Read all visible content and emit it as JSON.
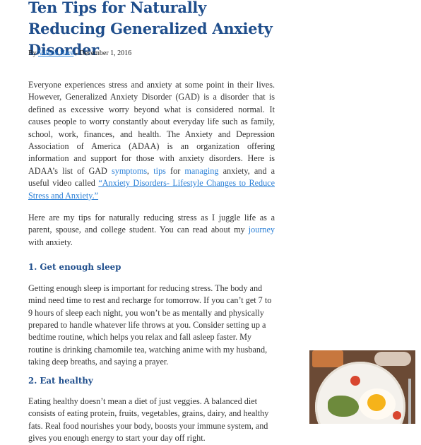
{
  "article": {
    "title": "Ten Tips for Naturally Reducing Generalized Anxiety Disorder",
    "byline": {
      "prefix": "By ",
      "author": "Valerie Hare",
      "separator": " - ",
      "date": "December 1, 2016"
    },
    "intro": {
      "text1": "Everyone experiences stress and anxiety at some point in their lives. However, Generalized Anxiety Disorder (GAD) is a disorder that is defined as excessive worry beyond what is considered normal. It causes people to worry constantly about everyday life such as family, school, work, finances, and health. The Anxiety and Depression Association of America (ADAA) is an organization offering information and support for those with anxiety disorders. Here is ADAA’s list of  GAD ",
      "link_symptoms": "symptoms",
      "text2": ", ",
      "link_tips": "tips",
      "text3": " for ",
      "link_managing": "managing",
      "text4": " anxiety, and a useful video called ",
      "link_video": "“Anxiety Disorders- Lifestyle Changes to Reduce Stress and Anxiety.”"
    },
    "second": {
      "text1": "Here are my tips for naturally reducing stress as I juggle life as a parent, spouse, and college student. You can read about my ",
      "link_journey": "journey",
      "text2": " with anxiety."
    },
    "sections": [
      {
        "heading": "1. Get enough sleep",
        "body": "Getting enough sleep is important for reducing stress. The body and mind need time to rest and recharge for tomorrow. If you can’t get 7 to 9 hours of sleep each night, you won’t be as mentally and physically prepared to handle whatever life throws at you. Consider setting up a bedtime routine, which helps you relax and fall asleep faster. My routine is drinking chamomile tea, watching anime with my husband, taking deep breaths, and saying a prayer."
      },
      {
        "heading": "2. Eat healthy",
        "body": "Eating healthy doesn’t mean a diet of just veggies. A balanced diet consists of eating protein, fruits, vegetables, grains, dairy, and healthy fats. Real food nourishes your body, boosts your immune system, and gives you enough energy to start your day off right."
      }
    ]
  },
  "colors": {
    "title": "#1f4e8c",
    "link": "#2a7fd6",
    "body_text": "#333333"
  }
}
